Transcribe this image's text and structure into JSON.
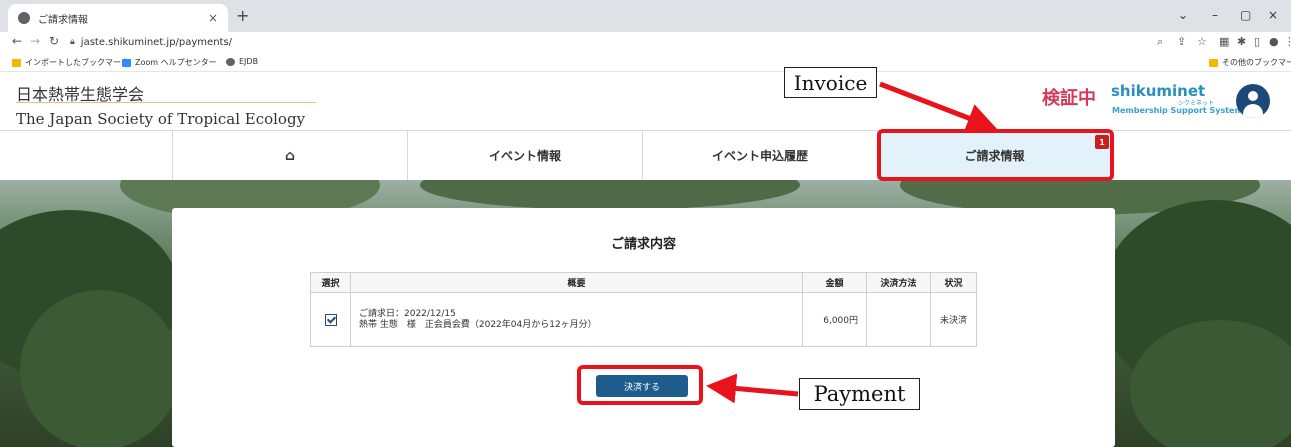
{
  "browser": {
    "tab_title": "ご請求情報",
    "tab_close": "×",
    "new_tab": "+",
    "url": "jaste.shikuminet.jp/payments/",
    "window_controls": [
      "⌄",
      "–",
      "▢",
      "×"
    ],
    "bookmarks": [
      {
        "label": "インポートしたブックマーク",
        "color": "#f2b900"
      },
      {
        "label": "Zoom ヘルプセンター",
        "color": "#2d8cff"
      },
      {
        "label": "EJDB",
        "color": "#5f6368"
      }
    ],
    "other_bookmarks": "その他のブックマーク"
  },
  "header": {
    "org_name_jp": "日本熱帯生態学会",
    "org_name_en": "The Japan Society of Tropical Ecology",
    "verification_label": "検証中",
    "logo_name": "shikuminet",
    "logo_kana": "シクミネット",
    "logo_subtitle": "Membership Support System"
  },
  "nav": {
    "home_icon": "⌂",
    "items": [
      {
        "label": "イベント情報"
      },
      {
        "label": "イベント申込履歴"
      },
      {
        "label": "ご請求情報",
        "badge": "1"
      }
    ]
  },
  "invoice": {
    "title": "ご請求内容",
    "columns": [
      "選択",
      "概要",
      "金額",
      "決済方法",
      "状況"
    ],
    "rows": [
      {
        "selected": true,
        "date_line": "ご請求日：2022/12/15",
        "summary_line": "熱帯 生態　様　正会員会費（2022年04月から12ヶ月分）",
        "amount": "6,000円",
        "payment_method": "",
        "status": "未決済"
      }
    ],
    "pay_button": "決済する"
  },
  "annotations": {
    "invoice_label": "Invoice",
    "payment_label": "Payment",
    "color": "#e8131b"
  }
}
